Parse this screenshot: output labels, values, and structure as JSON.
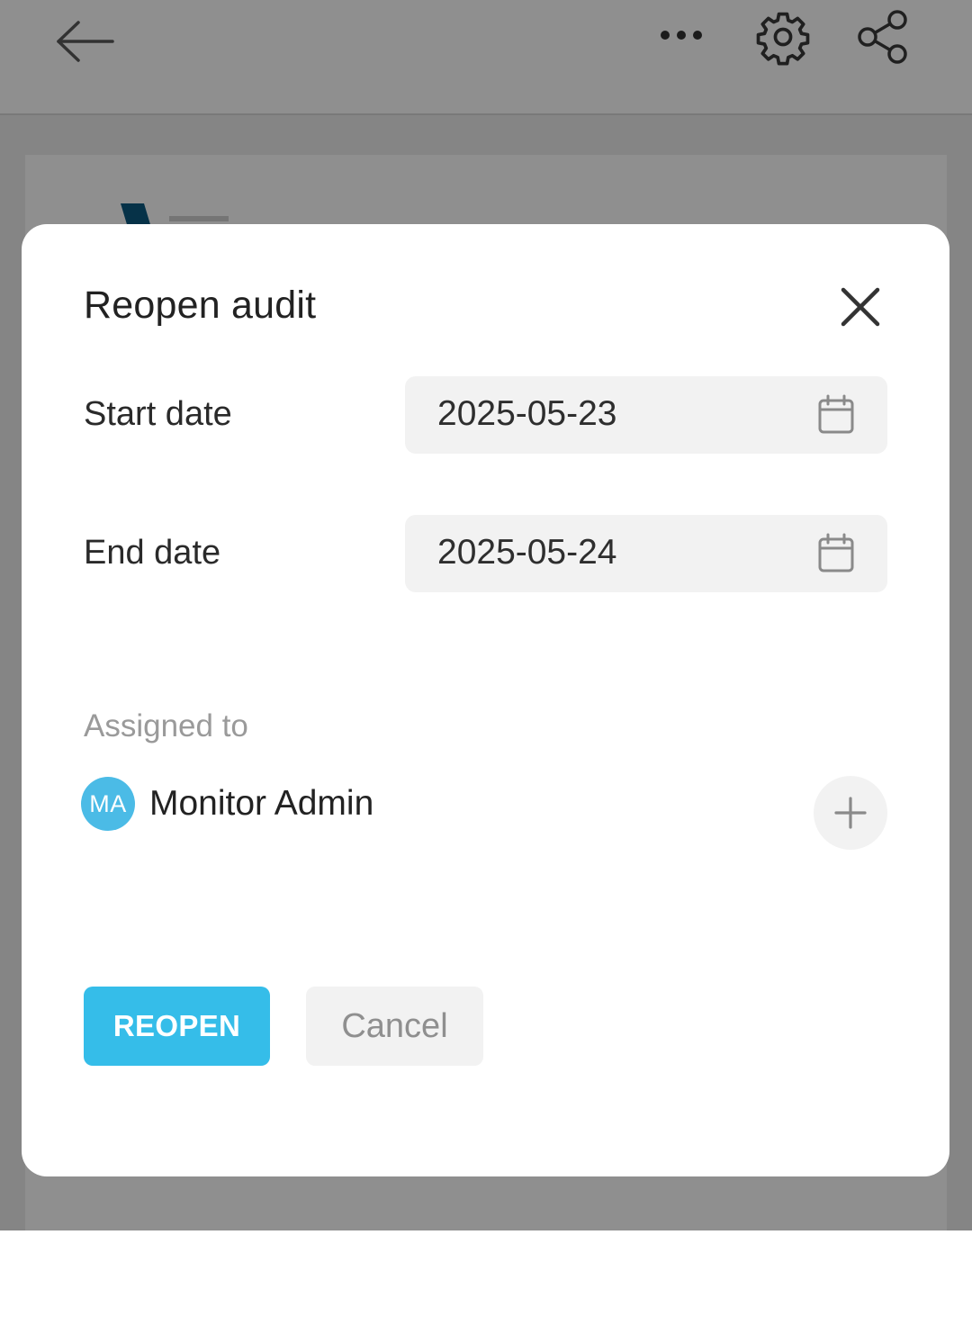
{
  "header": {
    "back_icon": "arrow-left-icon",
    "more_icon": "more-horizontal-icon",
    "settings_icon": "gear-icon",
    "share_icon": "share-icon"
  },
  "dialog": {
    "title": "Reopen audit",
    "close_icon": "close-icon",
    "start_date": {
      "label": "Start date",
      "value": "2025-05-23",
      "icon": "calendar-icon"
    },
    "end_date": {
      "label": "End date",
      "value": "2025-05-24",
      "icon": "calendar-icon"
    },
    "assigned": {
      "label": "Assigned to",
      "users": [
        {
          "initials": "MA",
          "name": "Monitor Admin",
          "avatar_color": "#4bbbe6"
        }
      ],
      "add_icon": "plus-icon"
    },
    "actions": {
      "reopen_label": "REOPEN",
      "cancel_label": "Cancel"
    }
  },
  "colors": {
    "accent": "#35bde9",
    "scrim": "rgba(0,0,0,0.44)",
    "field_background": "#f2f2f2",
    "logo": "#0b5a80"
  }
}
